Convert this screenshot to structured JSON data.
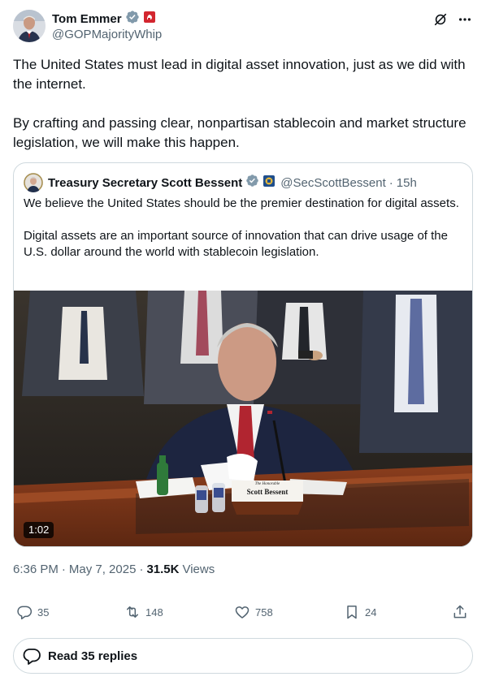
{
  "author": {
    "name": "Tom Emmer",
    "handle": "@GOPMajorityWhip"
  },
  "tweet": {
    "paragraphs": [
      "The United States must lead in digital asset innovation, just as we did with the internet.",
      "By crafting and passing clear, nonpartisan stablecoin and market structure legislation, we will make this happen."
    ]
  },
  "quote": {
    "name": "Treasury Secretary Scott Bessent",
    "handle": "@SecScottBessent",
    "separator": "·",
    "time": "15h",
    "paragraphs": [
      "We believe the United States should be the premier destination for digital assets.",
      "Digital assets are an important source of innovation that can drive usage of the U.S. dollar around the world with stablecoin legislation."
    ],
    "video": {
      "duration": "1:02",
      "nameplate_small": "The Honorable",
      "nameplate_name": "Scott Bessent"
    }
  },
  "meta": {
    "time": "6:36 PM",
    "sep1": "·",
    "date": "May 7, 2025",
    "sep2": "·",
    "views_count": "31.5K",
    "views_label": "Views"
  },
  "actions": {
    "replies": "35",
    "reposts": "148",
    "likes": "758",
    "bookmarks": "24"
  },
  "read_replies": {
    "label": "Read 35 replies"
  },
  "colors": {
    "verified": "#829aab",
    "text": "#0f1419",
    "secondary": "#536471",
    "border": "#cfd9de",
    "flag_red": "#d3262f"
  }
}
